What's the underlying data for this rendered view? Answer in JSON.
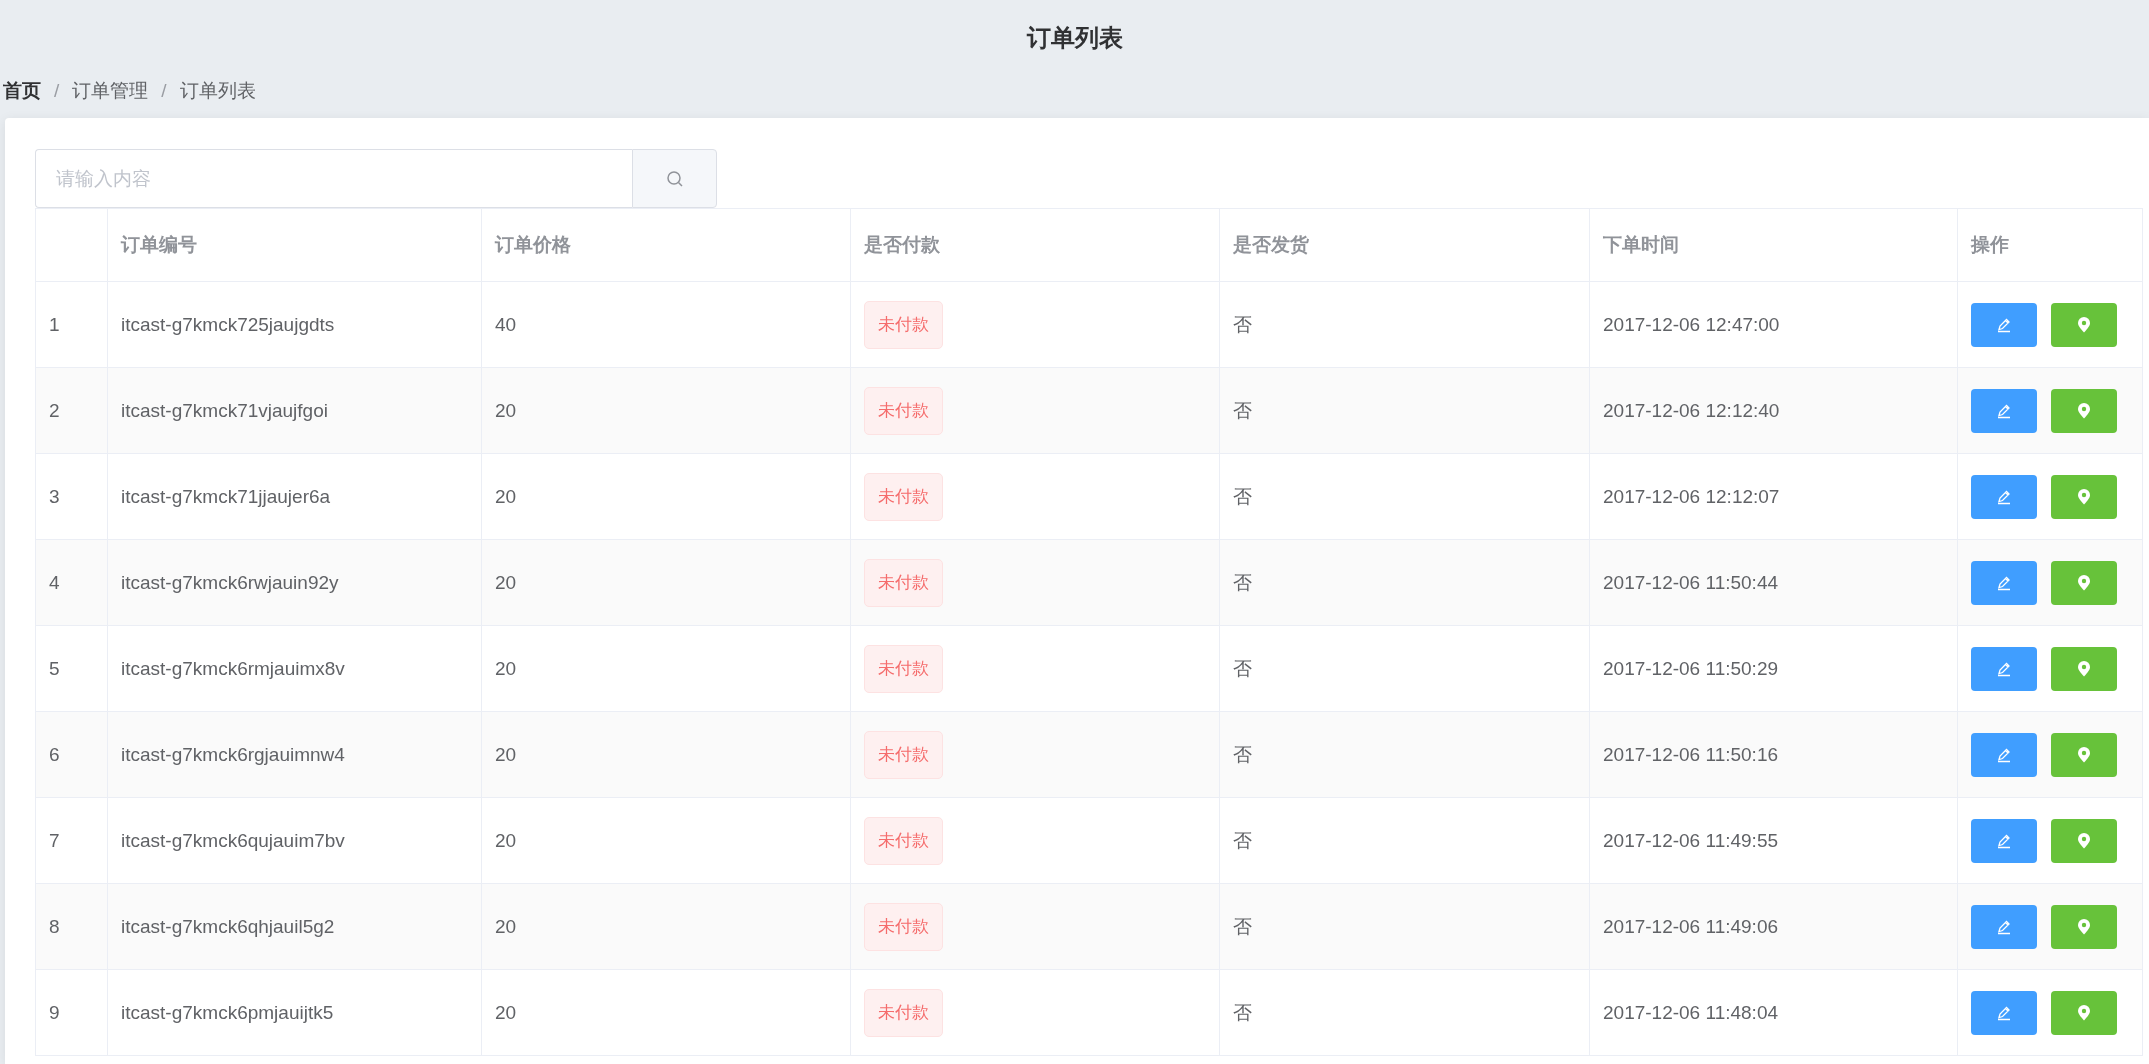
{
  "header": {
    "title": "订单列表"
  },
  "breadcrumb_separator": "/",
  "breadcrumb": [
    {
      "label": "首页",
      "link": true
    },
    {
      "label": "订单管理",
      "link": false
    },
    {
      "label": "订单列表",
      "link": false
    }
  ],
  "search": {
    "placeholder": "请输入内容"
  },
  "table": {
    "columns": [
      "订单编号",
      "订单价格",
      "是否付款",
      "是否发货",
      "下单时间",
      "操作"
    ],
    "rows": [
      {
        "index": "1",
        "order_number": "itcast-g7kmck725jaujgdts",
        "price": "40",
        "payment": {
          "label": "未付款",
          "paid": false
        },
        "shipped": "否",
        "time": "2017-12-06 12:47:00"
      },
      {
        "index": "2",
        "order_number": "itcast-g7kmck71vjaujfgoi",
        "price": "20",
        "payment": {
          "label": "未付款",
          "paid": false
        },
        "shipped": "否",
        "time": "2017-12-06 12:12:40"
      },
      {
        "index": "3",
        "order_number": "itcast-g7kmck71jjaujer6a",
        "price": "20",
        "payment": {
          "label": "未付款",
          "paid": false
        },
        "shipped": "否",
        "time": "2017-12-06 12:12:07"
      },
      {
        "index": "4",
        "order_number": "itcast-g7kmck6rwjauin92y",
        "price": "20",
        "payment": {
          "label": "未付款",
          "paid": false
        },
        "shipped": "否",
        "time": "2017-12-06 11:50:44"
      },
      {
        "index": "5",
        "order_number": "itcast-g7kmck6rmjauimx8v",
        "price": "20",
        "payment": {
          "label": "未付款",
          "paid": false
        },
        "shipped": "否",
        "time": "2017-12-06 11:50:29"
      },
      {
        "index": "6",
        "order_number": "itcast-g7kmck6rgjauimnw4",
        "price": "20",
        "payment": {
          "label": "未付款",
          "paid": false
        },
        "shipped": "否",
        "time": "2017-12-06 11:50:16"
      },
      {
        "index": "7",
        "order_number": "itcast-g7kmck6qujauim7bv",
        "price": "20",
        "payment": {
          "label": "未付款",
          "paid": false
        },
        "shipped": "否",
        "time": "2017-12-06 11:49:55"
      },
      {
        "index": "8",
        "order_number": "itcast-g7kmck6qhjauil5g2",
        "price": "20",
        "payment": {
          "label": "未付款",
          "paid": false
        },
        "shipped": "否",
        "time": "2017-12-06 11:49:06"
      },
      {
        "index": "9",
        "order_number": "itcast-g7kmck6pmjauijtk5",
        "price": "20",
        "payment": {
          "label": "未付款",
          "paid": false
        },
        "shipped": "否",
        "time": "2017-12-06 11:48:04"
      }
    ]
  }
}
